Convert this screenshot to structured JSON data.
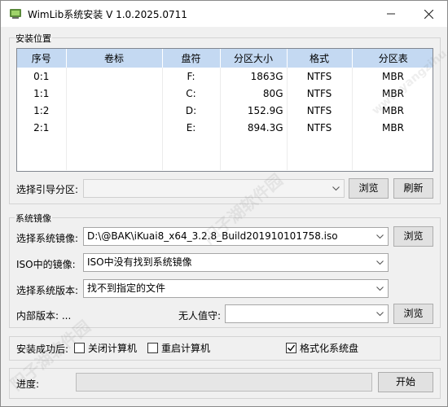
{
  "window": {
    "title": "WimLib系统安装 V 1.0.2025.0711",
    "minimize_icon": "minimize-icon",
    "close_icon": "close-icon"
  },
  "install_location": {
    "group_title": "安装位置",
    "columns": [
      "序号",
      "卷标",
      "盘符",
      "分区大小",
      "格式",
      "分区表"
    ],
    "rows": [
      {
        "index": "0:1",
        "label": "",
        "drive": "F:",
        "size": "1863G",
        "format": "NTFS",
        "table": "MBR"
      },
      {
        "index": "1:1",
        "label": "",
        "drive": "C:",
        "size": "80G",
        "format": "NTFS",
        "table": "MBR"
      },
      {
        "index": "1:2",
        "label": "",
        "drive": "D:",
        "size": "152.9G",
        "format": "NTFS",
        "table": "MBR"
      },
      {
        "index": "2:1",
        "label": "",
        "drive": "E:",
        "size": "894.3G",
        "format": "NTFS",
        "table": "MBR"
      }
    ],
    "boot_partition_label": "选择引导分区:",
    "boot_partition_value": "",
    "browse_label": "浏览",
    "refresh_label": "刷新"
  },
  "system_image": {
    "group_title": "系统镜像",
    "select_image_label": "选择系统镜像:",
    "select_image_value": "D:\\@BAK\\iKuai8_x64_3.2.8_Build201910101758.iso",
    "browse_label": "浏览",
    "iso_image_label": "ISO中的镜像:",
    "iso_image_value": "ISO中没有找到系统镜像",
    "version_label": "选择系统版本:",
    "version_value": "找不到指定的文件",
    "internal_version_label": "内部版本: ...",
    "unattend_label": "无人值守:",
    "unattend_value": "",
    "unattend_browse_label": "浏览"
  },
  "after_install": {
    "label": "安装成功后:",
    "options": [
      {
        "label": "关闭计算机",
        "checked": false
      },
      {
        "label": "重启计算机",
        "checked": false
      },
      {
        "label": "格式化系统盘",
        "checked": true
      }
    ]
  },
  "progress": {
    "label": "进度:",
    "value": 0,
    "start_label": "开始"
  },
  "watermark": {
    "text1": "阳子湖软件园",
    "text2": "www.yangzihu.com"
  }
}
